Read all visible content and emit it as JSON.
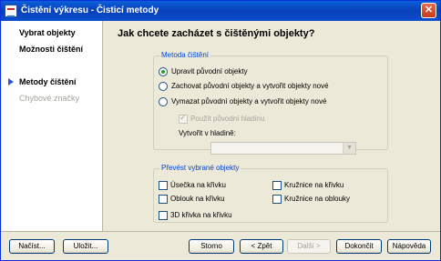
{
  "window": {
    "title": "Čistění výkresu - Čisticí metody",
    "close_glyph": "✕"
  },
  "sidebar": {
    "items": [
      {
        "label": "Vybrat objekty",
        "state": "normal"
      },
      {
        "label": "Možnosti čištění",
        "state": "normal"
      },
      {
        "label": "Metody čištění",
        "state": "current"
      },
      {
        "label": "Chybové značky",
        "state": "disabled"
      }
    ]
  },
  "main": {
    "heading": "Jak chcete zacházet s čištěnými objekty?",
    "method_group": {
      "legend": "Metoda čištění",
      "options": [
        {
          "label": "Upravit původní objekty",
          "selected": true
        },
        {
          "label": "Zachovat původní objekty a vytvořit objekty nové",
          "selected": false
        },
        {
          "label": "Vymazat původní objekty a vytvořit objekty nové",
          "selected": false
        }
      ],
      "use_original_layer": {
        "label": "Použít původní hladinu",
        "checked": true,
        "enabled": false
      },
      "create_in_layer": {
        "label": "Vytvořit v hladině:",
        "value": "",
        "enabled": false
      }
    },
    "convert_group": {
      "legend": "Převést vybrané objekty",
      "options": [
        {
          "label": "Úsečka na křivku",
          "checked": false
        },
        {
          "label": "Kružnice na křivku",
          "checked": false
        },
        {
          "label": "Oblouk na křivku",
          "checked": false
        },
        {
          "label": "Kružnice na oblouky",
          "checked": false
        },
        {
          "label": "3D křivka na křivku",
          "checked": false
        }
      ]
    }
  },
  "footer": {
    "load": "Načíst...",
    "save": "Uložit...",
    "cancel": "Storno",
    "back": "< Zpět",
    "next": "Další >",
    "finish": "Dokončit",
    "help": "Nápověda"
  },
  "colors": {
    "title_bar": "#0a5fd8",
    "accent_arrow": "#2a5bd3",
    "group_legend": "#0046d5",
    "radio_dot": "#21a121",
    "dialog_bg": "#ece9d8"
  },
  "icons": {
    "app": "drawing-cleanup-icon",
    "close": "close-icon",
    "current_step": "arrow-right-icon",
    "dropdown": "chevron-down-icon"
  }
}
